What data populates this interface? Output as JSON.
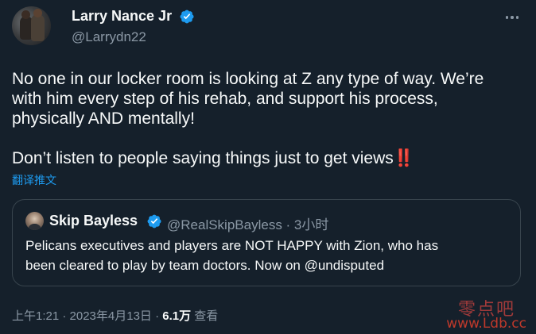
{
  "author": {
    "name": "Larry Nance Jr",
    "handle": "@Larrydn22",
    "verified": true
  },
  "tweet": {
    "lines": [
      "No one in our locker room is looking at Z any type of way. We’re",
      "with him every step of his rehab, and support his process,",
      "physically AND mentally!"
    ],
    "line2": "Don’t listen to people saying things just to get views",
    "emoji": "‼️",
    "translate_label": "翻译推文"
  },
  "quote": {
    "name": "Skip Bayless",
    "verified": true,
    "handle_time": "@RealSkipBayless · 3小时",
    "lines": [
      "Pelicans executives and players are NOT HAPPY with Zion, who has",
      "been cleared to play by team doctors. Now on @undisputed"
    ]
  },
  "meta": {
    "timestamp": "上午1:21 · 2023年4月13日 · ",
    "views_count": "6.1万",
    "views_label": " 查看"
  },
  "watermark": {
    "cn": "零点吧",
    "url": "www.Ldb.cc"
  },
  "colors": {
    "background": "#15202b",
    "text": "#f7f9f9",
    "secondary": "#8b98a5",
    "accent": "#1d9bf0",
    "border": "#38444d"
  },
  "icons": {
    "verified": "verified-badge-icon",
    "more": "more-horizontal-icon"
  }
}
